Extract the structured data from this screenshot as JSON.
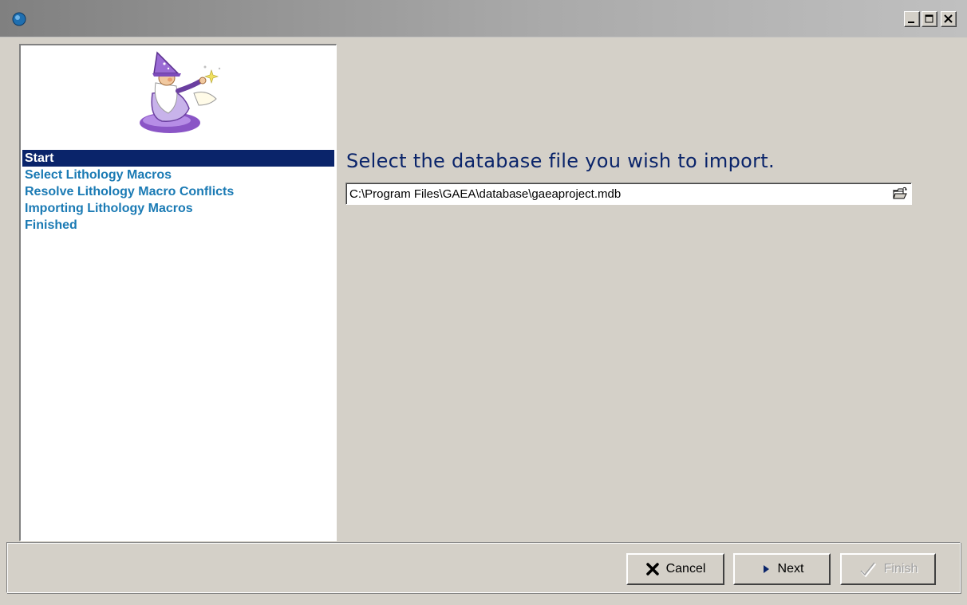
{
  "window": {
    "title": "",
    "controls": {
      "minimize_icon": "minimize-icon",
      "maximize_icon": "maximize-icon",
      "close_icon": "close-icon"
    }
  },
  "sidebar": {
    "illustration": "wizard-icon",
    "steps": [
      {
        "label": "Start",
        "active": true
      },
      {
        "label": "Select Lithology Macros",
        "active": false
      },
      {
        "label": "Resolve Lithology Macro Conflicts",
        "active": false
      },
      {
        "label": "Importing Lithology Macros",
        "active": false
      },
      {
        "label": "Finished",
        "active": false
      }
    ]
  },
  "main": {
    "heading": "Select the database file you wish to import.",
    "file_path": "C:\\Program Files\\GAEA\\database\\gaeaproject.mdb",
    "browse_icon": "folder-open-icon"
  },
  "footer": {
    "cancel_label": "Cancel",
    "next_label": "Next",
    "finish_label": "Finish",
    "finish_enabled": false
  },
  "colors": {
    "selection": "#0a246a",
    "step_text": "#1a7ab4",
    "heading": "#0a246a",
    "face": "#d4d0c8"
  }
}
